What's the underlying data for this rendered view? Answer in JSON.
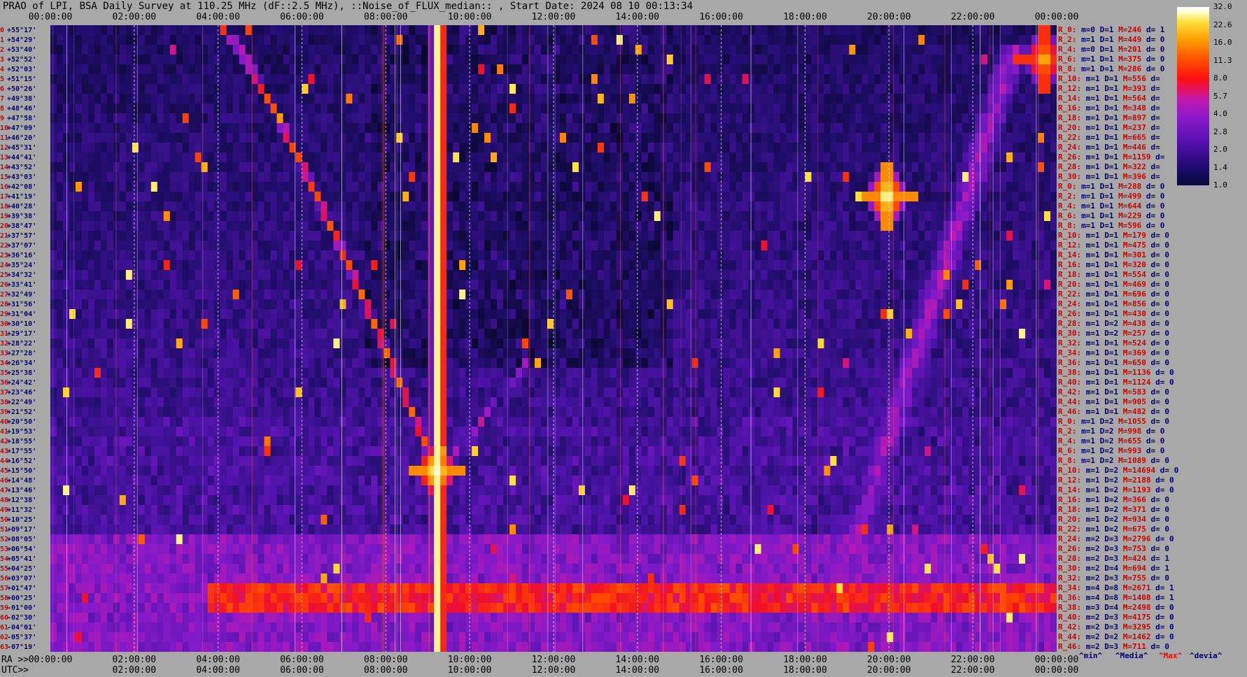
{
  "title": "PRAO of LPI, BSA Daily Survey at 110.25 MHz (dF::2.5 MHz), ::Noise_of_FLUX_median:: , Start Date: 2024 08 10 00:13:34",
  "top_time_labels": [
    "00:00:00",
    "02:00:00",
    "04:00:00",
    "06:00:00",
    "08:00:00",
    "10:00:00",
    "12:00:00",
    "14:00:00",
    "16:00:00",
    "18:00:00",
    "20:00:00",
    "22:00:00",
    "00:00:00"
  ],
  "bottom_ra": {
    "caption": "RA >>",
    "labels": [
      "00:00:00",
      "02:00:00",
      "04:00:00",
      "06:00:00",
      "08:00:00",
      "10:00:00",
      "12:00:00",
      "14:00:00",
      "16:00:00",
      "18:00:00",
      "20:00:00",
      "22:00:00",
      "00:00:00"
    ]
  },
  "bottom_utc": {
    "caption": "UTC>>",
    "labels": [
      "02:00:00",
      "04:00:00",
      "06:00:00",
      "08:00:00",
      "10:00:00",
      "12:00:00",
      "14:00:00",
      "16:00:00",
      "18:00:00",
      "20:00:00",
      "22:00:00",
      "00:00:00"
    ]
  },
  "declinations": [
    {
      "i": "0",
      "d": "+55°17'"
    },
    {
      "i": "1",
      "d": "+54°29'"
    },
    {
      "i": "2",
      "d": "+53°40'"
    },
    {
      "i": "3",
      "d": "+52°52'"
    },
    {
      "i": "4",
      "d": "+52°03'"
    },
    {
      "i": "5",
      "d": "+51°15'"
    },
    {
      "i": "6",
      "d": "+50°26'"
    },
    {
      "i": "7",
      "d": "+49°38'"
    },
    {
      "i": "8",
      "d": "+48°46'"
    },
    {
      "i": "9",
      "d": "+47°58'"
    },
    {
      "i": "10",
      "d": "+47°09'"
    },
    {
      "i": "11",
      "d": "+46°20'"
    },
    {
      "i": "12",
      "d": "+45°31'"
    },
    {
      "i": "13",
      "d": "+44°41'"
    },
    {
      "i": "14",
      "d": "+43°52'"
    },
    {
      "i": "15",
      "d": "+43°03'"
    },
    {
      "i": "16",
      "d": "+42°08'"
    },
    {
      "i": "17",
      "d": "+41°19'"
    },
    {
      "i": "18",
      "d": "+40°28'"
    },
    {
      "i": "19",
      "d": "+39°38'"
    },
    {
      "i": "20",
      "d": "+38°47'"
    },
    {
      "i": "21",
      "d": "+37°57'"
    },
    {
      "i": "22",
      "d": "+37°07'"
    },
    {
      "i": "23",
      "d": "+36°16'"
    },
    {
      "i": "24",
      "d": "+35°24'"
    },
    {
      "i": "25",
      "d": "+34°32'"
    },
    {
      "i": "26",
      "d": "+33°41'"
    },
    {
      "i": "27",
      "d": "+32°49'"
    },
    {
      "i": "28",
      "d": "+31°56'"
    },
    {
      "i": "29",
      "d": "+31°04'"
    },
    {
      "i": "30",
      "d": "+30°10'"
    },
    {
      "i": "31",
      "d": "+29°17'"
    },
    {
      "i": "32",
      "d": "+28°22'"
    },
    {
      "i": "33",
      "d": "+27°28'"
    },
    {
      "i": "34",
      "d": "+26°34'"
    },
    {
      "i": "35",
      "d": "+25°38'"
    },
    {
      "i": "36",
      "d": "+24°42'"
    },
    {
      "i": "37",
      "d": "+23°46'"
    },
    {
      "i": "38",
      "d": "+22°49'"
    },
    {
      "i": "39",
      "d": "+21°52'"
    },
    {
      "i": "40",
      "d": "+20°50'"
    },
    {
      "i": "41",
      "d": "+19°53'"
    },
    {
      "i": "42",
      "d": "+18°55'"
    },
    {
      "i": "43",
      "d": "+17°55'"
    },
    {
      "i": "44",
      "d": "+16°52'"
    },
    {
      "i": "45",
      "d": "+15°50'"
    },
    {
      "i": "46",
      "d": "+14°48'"
    },
    {
      "i": "47",
      "d": "+13°46'"
    },
    {
      "i": "48",
      "d": "+12°38'"
    },
    {
      "i": "49",
      "d": "+11°32'"
    },
    {
      "i": "50",
      "d": "+10°25'"
    },
    {
      "i": "51",
      "d": "+09°17'"
    },
    {
      "i": "52",
      "d": "+08°05'"
    },
    {
      "i": "53",
      "d": "+06°54'"
    },
    {
      "i": "54",
      "d": "+05°41'"
    },
    {
      "i": "55",
      "d": "+04°25'"
    },
    {
      "i": "56",
      "d": "+03°07'"
    },
    {
      "i": "57",
      "d": "+01°47'"
    },
    {
      "i": "58",
      "d": "+00°25'"
    },
    {
      "i": "59",
      "d": "-01°00'"
    },
    {
      "i": "60",
      "d": "-02°30'"
    },
    {
      "i": "61",
      "d": "-04°01'"
    },
    {
      "i": "62",
      "d": "-05°37'"
    },
    {
      "i": "63",
      "d": "-07°19'"
    }
  ],
  "stats": [
    {
      "r": "R_0:",
      "m": "m=0",
      "D": "D=1",
      "M": "M=246",
      "d": "d= 1"
    },
    {
      "r": "R_2:",
      "m": "m=1",
      "D": "D=1",
      "M": "M=449",
      "d": "d= 0"
    },
    {
      "r": "R_4:",
      "m": "m=0",
      "D": "D=1",
      "M": "M=201",
      "d": "d= 0"
    },
    {
      "r": "R_6:",
      "m": "m=1",
      "D": "D=1",
      "M": "M=375",
      "d": "d= 0"
    },
    {
      "r": "R_8:",
      "m": "m=1",
      "D": "D=1",
      "M": "M=286",
      "d": "d= 0"
    },
    {
      "r": "R_10:",
      "m": "m=1",
      "D": "D=1",
      "M": "M=556",
      "d": "d="
    },
    {
      "r": "R_12:",
      "m": "m=1",
      "D": "D=1",
      "M": "M=393",
      "d": "d="
    },
    {
      "r": "R_14:",
      "m": "m=1",
      "D": "D=1",
      "M": "M=564",
      "d": "d="
    },
    {
      "r": "R_16:",
      "m": "m=1",
      "D": "D=1",
      "M": "M=348",
      "d": "d="
    },
    {
      "r": "R_18:",
      "m": "m=1",
      "D": "D=1",
      "M": "M=897",
      "d": "d="
    },
    {
      "r": "R_20:",
      "m": "m=1",
      "D": "D=1",
      "M": "M=237",
      "d": "d="
    },
    {
      "r": "R_22:",
      "m": "m=1",
      "D": "D=1",
      "M": "M=665",
      "d": "d="
    },
    {
      "r": "R_24:",
      "m": "m=1",
      "D": "D=1",
      "M": "M=446",
      "d": "d="
    },
    {
      "r": "R_26:",
      "m": "m=1",
      "D": "D=1",
      "M": "M=1159",
      "d": "d="
    },
    {
      "r": "R_28:",
      "m": "m=1",
      "D": "D=1",
      "M": "M=322",
      "d": "d="
    },
    {
      "r": "R_30:",
      "m": "m=1",
      "D": "D=1",
      "M": "M=396",
      "d": "d="
    },
    {
      "r": "R_0:",
      "m": "m=1",
      "D": "D=1",
      "M": "M=288",
      "d": "d= 0"
    },
    {
      "r": "R_2:",
      "m": "m=1",
      "D": "D=1",
      "M": "M=499",
      "d": "d= 0"
    },
    {
      "r": "R_4:",
      "m": "m=1",
      "D": "D=1",
      "M": "M=644",
      "d": "d= 0"
    },
    {
      "r": "R_6:",
      "m": "m=1",
      "D": "D=1",
      "M": "M=229",
      "d": "d= 0"
    },
    {
      "r": "R_8:",
      "m": "m=1",
      "D": "D=1",
      "M": "M=596",
      "d": "d= 0"
    },
    {
      "r": "R_10:",
      "m": "m=1",
      "D": "D=1",
      "M": "M=179",
      "d": "d= 0"
    },
    {
      "r": "R_12:",
      "m": "m=1",
      "D": "D=1",
      "M": "M=475",
      "d": "d= 0"
    },
    {
      "r": "R_14:",
      "m": "m=1",
      "D": "D=1",
      "M": "M=301",
      "d": "d= 0"
    },
    {
      "r": "R_16:",
      "m": "m=1",
      "D": "D=1",
      "M": "M=320",
      "d": "d= 0"
    },
    {
      "r": "R_18:",
      "m": "m=1",
      "D": "D=1",
      "M": "M=554",
      "d": "d= 0"
    },
    {
      "r": "R_20:",
      "m": "m=1",
      "D": "D=1",
      "M": "M=469",
      "d": "d= 0"
    },
    {
      "r": "R_22:",
      "m": "m=1",
      "D": "D=1",
      "M": "M=696",
      "d": "d= 0"
    },
    {
      "r": "R_24:",
      "m": "m=1",
      "D": "D=1",
      "M": "M=856",
      "d": "d= 0"
    },
    {
      "r": "R_26:",
      "m": "m=1",
      "D": "D=1",
      "M": "M=430",
      "d": "d= 0"
    },
    {
      "r": "R_28:",
      "m": "m=1",
      "D": "D=2",
      "M": "M=438",
      "d": "d= 0"
    },
    {
      "r": "R_30:",
      "m": "m=1",
      "D": "D=2",
      "M": "M=257",
      "d": "d= 0"
    },
    {
      "r": "R_32:",
      "m": "m=1",
      "D": "D=1",
      "M": "M=524",
      "d": "d= 0"
    },
    {
      "r": "R_34:",
      "m": "m=1",
      "D": "D=1",
      "M": "M=369",
      "d": "d= 0"
    },
    {
      "r": "R_36:",
      "m": "m=1",
      "D": "D=1",
      "M": "M=650",
      "d": "d= 0"
    },
    {
      "r": "R_38:",
      "m": "m=1",
      "D": "D=1",
      "M": "M=1136",
      "d": "d= 0"
    },
    {
      "r": "R_40:",
      "m": "m=1",
      "D": "D=1",
      "M": "M=1124",
      "d": "d= 0"
    },
    {
      "r": "R_42:",
      "m": "m=1",
      "D": "D=1",
      "M": "M=583",
      "d": "d= 0"
    },
    {
      "r": "R_44:",
      "m": "m=1",
      "D": "D=1",
      "M": "M=905",
      "d": "d= 0"
    },
    {
      "r": "R_46:",
      "m": "m=1",
      "D": "D=1",
      "M": "M=482",
      "d": "d= 0"
    },
    {
      "r": "R_0:",
      "m": "m=1",
      "D": "D=2",
      "M": "M=1055",
      "d": "d= 0"
    },
    {
      "r": "R_2:",
      "m": "m=1",
      "D": "D=2",
      "M": "M=998",
      "d": "d= 0"
    },
    {
      "r": "R_4:",
      "m": "m=1",
      "D": "D=2",
      "M": "M=655",
      "d": "d= 0"
    },
    {
      "r": "R_6:",
      "m": "m=1",
      "D": "D=2",
      "M": "M=993",
      "d": "d= 0"
    },
    {
      "r": "R_8:",
      "m": "m=1",
      "D": "D=2",
      "M": "M=1089",
      "d": "d= 0"
    },
    {
      "r": "R_10:",
      "m": "m=1",
      "D": "D=2",
      "M": "M=14694",
      "d": "d= 0"
    },
    {
      "r": "R_12:",
      "m": "m=1",
      "D": "D=2",
      "M": "M=2188",
      "d": "d= 0"
    },
    {
      "r": "R_14:",
      "m": "m=1",
      "D": "D=2",
      "M": "M=1193",
      "d": "d= 0"
    },
    {
      "r": "R_16:",
      "m": "m=1",
      "D": "D=2",
      "M": "M=366",
      "d": "d= 0"
    },
    {
      "r": "R_18:",
      "m": "m=1",
      "D": "D=2",
      "M": "M=371",
      "d": "d= 0"
    },
    {
      "r": "R_20:",
      "m": "m=1",
      "D": "D=2",
      "M": "M=934",
      "d": "d= 0"
    },
    {
      "r": "R_22:",
      "m": "m=1",
      "D": "D=2",
      "M": "M=675",
      "d": "d= 0"
    },
    {
      "r": "R_24:",
      "m": "m=2",
      "D": "D=3",
      "M": "M=2796",
      "d": "d= 0"
    },
    {
      "r": "R_26:",
      "m": "m=2",
      "D": "D=3",
      "M": "M=753",
      "d": "d= 0"
    },
    {
      "r": "R_28:",
      "m": "m=2",
      "D": "D=3",
      "M": "M=424",
      "d": "d= 1"
    },
    {
      "r": "R_30:",
      "m": "m=2",
      "D": "D=4",
      "M": "M=694",
      "d": "d= 1"
    },
    {
      "r": "R_32:",
      "m": "m=2",
      "D": "D=3",
      "M": "M=755",
      "d": "d= 0"
    },
    {
      "r": "R_34:",
      "m": "m=4",
      "D": "D=8",
      "M": "M=2671",
      "d": "d= 1"
    },
    {
      "r": "R_36:",
      "m": "m=4",
      "D": "D=8",
      "M": "M=1408",
      "d": "d= 1"
    },
    {
      "r": "R_38:",
      "m": "m=3",
      "D": "D=4",
      "M": "M=2498",
      "d": "d= 0"
    },
    {
      "r": "R_40:",
      "m": "m=2",
      "D": "D=3",
      "M": "M=4175",
      "d": "d= 0"
    },
    {
      "r": "R_42:",
      "m": "m=2",
      "D": "D=3",
      "M": "M=3295",
      "d": "d= 0"
    },
    {
      "r": "R_44:",
      "m": "m=2",
      "D": "D=2",
      "M": "M=1462",
      "d": "d= 0"
    },
    {
      "r": "R_46:",
      "m": "m=2",
      "D": "D=3",
      "M": "M=711",
      "d": "d= 0"
    }
  ],
  "legend": {
    "min": "^min^",
    "median": "^Media^",
    "max": "^Max^",
    "devia": "^devia^"
  },
  "colors": {
    "background": "#a8a8a8",
    "label_red": "#d00000",
    "label_blue": "#00007a",
    "legend_max_red": "#ff0000"
  },
  "chart_data": {
    "type": "heatmap",
    "x_axis": "RA / UTC time, 00:00:00 to 00:00:00 (24 h)",
    "y_axis": "Declination, +55°17' to -07°19' (64 rows)",
    "colorbar": {
      "ticks": [
        "32.0",
        "22.6",
        "16.0",
        "11.3",
        "8.0",
        "5.7",
        "4.0",
        "2.8",
        "2.0",
        "1.4",
        "1.0"
      ],
      "scale": "log2",
      "range": [
        1.0,
        32.0
      ]
    },
    "features": [
      {
        "name": "",
        "kind": "vertical_band",
        "ra_h": 9.25,
        "dec_range": [
          "+55°17'",
          "-07°19'"
        ],
        "peak": 32
      },
      {
        "name": "",
        "kind": "point_source",
        "ra_h": 9.2,
        "dec_row": 45,
        "peak": 32
      },
      {
        "name": "",
        "kind": "point_source",
        "ra_h": 19.95,
        "dec_row": 17,
        "peak": 32
      },
      {
        "name": "",
        "kind": "point_source",
        "ra_h": 23.7,
        "dec_row": 3,
        "peak": 22.6
      },
      {
        "name": "",
        "kind": "arc",
        "from": {
          "ra_h": 4.15,
          "dec_row": 0
        },
        "to": {
          "ra_h": 9.2,
          "dec_row": 45
        },
        "peak": 16
      },
      {
        "name": "",
        "kind": "arc",
        "from": {
          "ra_h": 9.2,
          "dec_row": 45
        },
        "to": {
          "ra_h": 11.3,
          "dec_row": 34
        },
        "peak": 8
      },
      {
        "name": "",
        "kind": "horizontal_band",
        "dec_rows": [
          57,
          59
        ],
        "ra_h_from": 3.7,
        "ra_h_to": 24,
        "peak": 16
      },
      {
        "name": "",
        "kind": "horizontal_band",
        "dec_rows": [
          52,
          63
        ],
        "ra_h_from": 0,
        "ra_h_to": 24,
        "peak": 6
      },
      {
        "name": "",
        "kind": "diffuse_arc",
        "from": {
          "ra_h": 18.6,
          "dec_row": 60
        },
        "to": {
          "ra_h": 23.0,
          "dec_row": 2
        },
        "peak": 8
      }
    ]
  }
}
